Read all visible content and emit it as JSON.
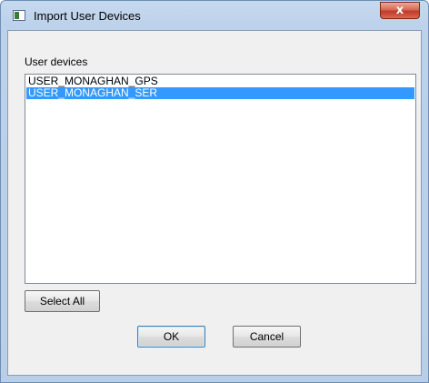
{
  "window": {
    "title": "Import User Devices",
    "close_glyph": "x"
  },
  "dialog": {
    "list_label": "User devices",
    "devices": [
      {
        "name": "USER_MONAGHAN_GPS",
        "selected": false
      },
      {
        "name": "USER_MONAGHAN_SER",
        "selected": true
      }
    ],
    "select_all_label": "Select All",
    "ok_label": "OK",
    "cancel_label": "Cancel"
  },
  "colors": {
    "selection": "#3399ff",
    "close_button": "#c0392b",
    "title_bar": "#bcd1ea"
  }
}
